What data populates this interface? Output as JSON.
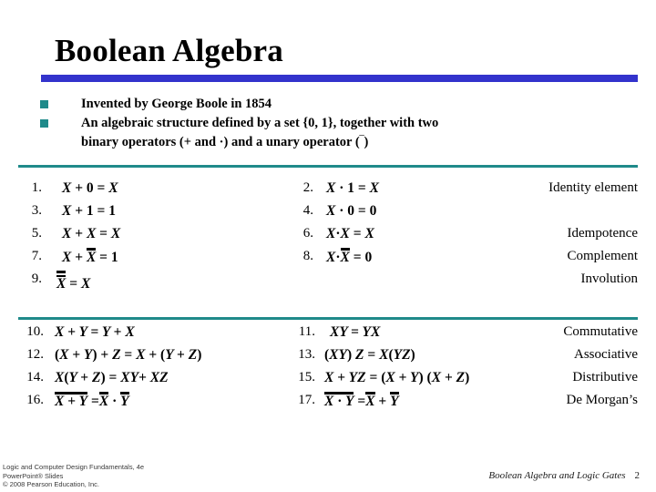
{
  "slide": {
    "title": "Boolean Algebra",
    "accent_blue": "#3333CC",
    "accent_teal": "#1F8A8A",
    "background": "#FFFFFF"
  },
  "bullets": [
    {
      "marker": "square-bullet",
      "text": "Invented by George Boole in 1854"
    },
    {
      "marker": "square-bullet",
      "text": "An algebraic structure defined by a set {0, 1}, together with two"
    },
    {
      "marker": "none",
      "text": "binary operators (+ and ·) and a unary operator (‾)"
    }
  ],
  "table_upper": [
    {
      "left_num": "1.",
      "left_eq": "X + 0 = X",
      "right_num": "2.",
      "right_eq": "X · 1 = X",
      "label": "Identity element"
    },
    {
      "left_num": "3.",
      "left_eq": "X + 1 = 1",
      "right_num": "4.",
      "right_eq": "X · 0 = 0",
      "label": ""
    },
    {
      "left_num": "5.",
      "left_eq": "X + X = X",
      "right_num": "6.",
      "right_eq": "X·X = X",
      "label": "Idempotence"
    },
    {
      "left_num": "7.",
      "left_eq": "X + X̅ = 1",
      "right_num": "8.",
      "right_eq": "X·X̅ = 0",
      "label": "Complement"
    },
    {
      "left_num": "9.",
      "left_eq": "X̅̅ = X",
      "right_num": "",
      "right_eq": "",
      "label": "Involution"
    }
  ],
  "table_lower": [
    {
      "left_num": "10.",
      "left_eq": "X + Y = Y + X",
      "right_num": "11.",
      "right_eq": "XY = YX",
      "label": "Commutative"
    },
    {
      "left_num": "12.",
      "left_eq": "(X + Y) + Z = X + (Y + Z)",
      "right_num": "13.",
      "right_eq": "(XY) Z = X(YZ)",
      "label": "Associative"
    },
    {
      "left_num": "14.",
      "left_eq": "X(Y + Z) = XY + XZ",
      "right_num": "15.",
      "right_eq": "X + YZ = (X + Y) (X + Z)",
      "label": "Distributive"
    },
    {
      "left_num": "16.",
      "left_eq": "X + Y̅ = X̅ · Y̅",
      "right_num": "17.",
      "right_eq": "X · Y̅ = X̅ + Y̅",
      "label": "De Morgan's"
    }
  ],
  "footer": {
    "credit_line1": "Logic and Computer Design Fundamentals, 4e",
    "credit_line2": "PowerPoint® Slides",
    "credit_line3": "© 2008 Pearson Education, Inc.",
    "chapter": "Boolean Algebra and Logic Gates",
    "page_number": "2"
  }
}
